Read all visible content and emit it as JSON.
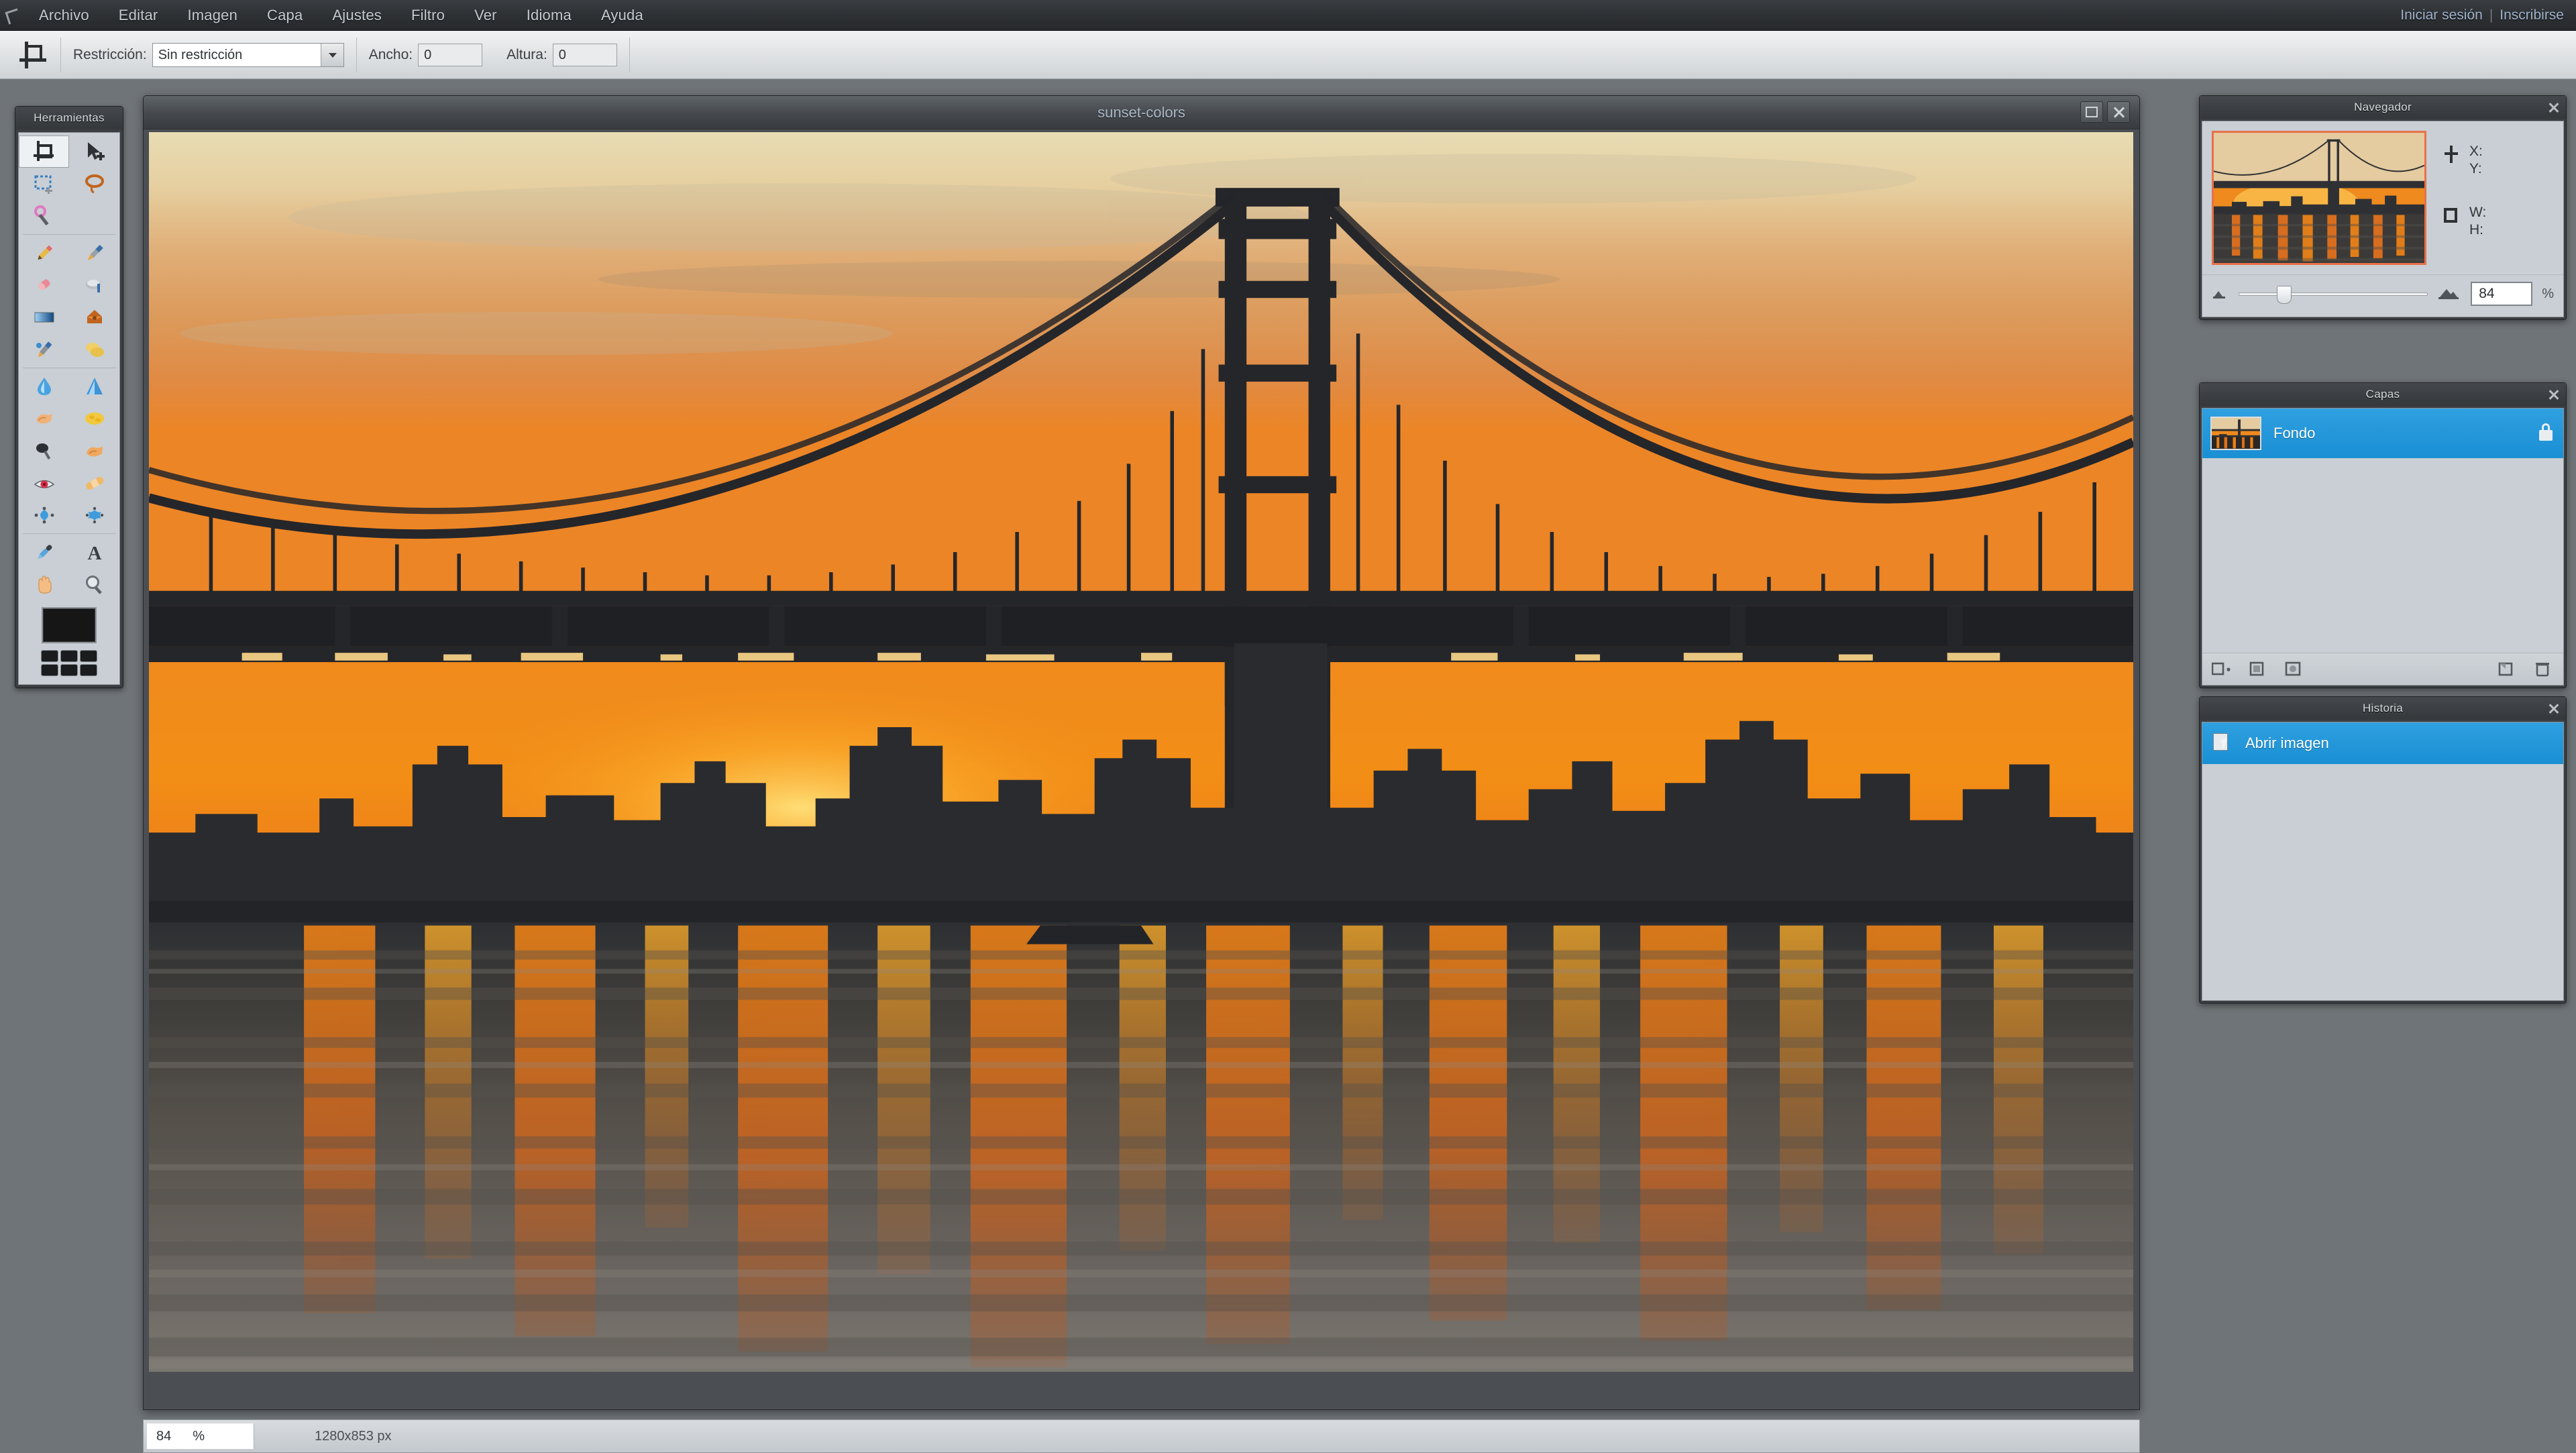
{
  "menubar": {
    "logo_icon": "crop-logo-icon",
    "items": [
      "Archivo",
      "Editar",
      "Imagen",
      "Capa",
      "Ajustes",
      "Filtro",
      "Ver",
      "Idioma",
      "Ayuda"
    ],
    "account": {
      "sign_in": "Iniciar sesión",
      "separator": "|",
      "sign_up": "Inscribirse"
    }
  },
  "options_bar": {
    "tool_icon": "crop-tool-icon",
    "constraint_label": "Restricción:",
    "constraint_value": "Sin restricción",
    "constraint_options": [
      "Sin restricción"
    ],
    "width_label": "Ancho:",
    "width_value": "0",
    "height_label": "Altura:",
    "height_value": "0"
  },
  "tools_panel": {
    "title": "Herramientas",
    "active_tool": "crop-tool",
    "tools": [
      {
        "name": "crop-tool",
        "icon": "crop-icon",
        "active": true
      },
      {
        "name": "move-tool",
        "icon": "arrow-move-icon",
        "active": false
      },
      {
        "name": "marquee-select-tool",
        "icon": "rectangle-marquee-icon",
        "active": false
      },
      {
        "name": "lasso-tool",
        "icon": "lasso-icon",
        "active": false
      },
      {
        "name": "wand-select-tool",
        "icon": "magic-wand-icon",
        "active": false
      },
      {
        "name": "pencil-tool",
        "icon": "pencil-icon",
        "active": false
      },
      {
        "name": "brush-tool",
        "icon": "paintbrush-icon",
        "active": false
      },
      {
        "name": "eraser-tool",
        "icon": "eraser-icon",
        "active": false
      },
      {
        "name": "clone-stamp-tool",
        "icon": "clone-stamp-icon",
        "active": false
      },
      {
        "name": "gradient-tool",
        "icon": "gradient-icon",
        "active": false
      },
      {
        "name": "paint-bucket-tool",
        "icon": "paint-bucket-icon",
        "active": false
      },
      {
        "name": "replace-color-tool",
        "icon": "color-replace-icon",
        "active": false
      },
      {
        "name": "drawing-tool",
        "icon": "shapes-icon",
        "active": false
      },
      {
        "name": "blur-tool",
        "icon": "water-drop-icon",
        "active": false
      },
      {
        "name": "sharpen-tool",
        "icon": "sharpen-triangle-icon",
        "active": false
      },
      {
        "name": "smudge-tool",
        "icon": "smudge-finger-icon",
        "active": false
      },
      {
        "name": "sponge-tool",
        "icon": "sponge-icon",
        "active": false
      },
      {
        "name": "dodge-tool",
        "icon": "dodge-icon",
        "active": false
      },
      {
        "name": "burn-tool",
        "icon": "burn-hand-icon",
        "active": false
      },
      {
        "name": "red-eye-tool",
        "icon": "red-eye-icon",
        "active": false
      },
      {
        "name": "spot-heal-tool",
        "icon": "bandage-icon",
        "active": false
      },
      {
        "name": "bloat-tool",
        "icon": "bloat-icon",
        "active": false
      },
      {
        "name": "pinch-tool",
        "icon": "pinch-star-icon",
        "active": false
      },
      {
        "name": "eyedropper-tool",
        "icon": "eyedropper-icon",
        "active": false
      },
      {
        "name": "type-tool",
        "icon": "text-a-icon",
        "active": false
      },
      {
        "name": "hand-tool",
        "icon": "hand-icon",
        "active": false
      },
      {
        "name": "zoom-tool",
        "icon": "magnifier-icon",
        "active": false
      }
    ],
    "foreground_color": "#161616",
    "palette_colors": [
      "#1b1c1d",
      "#1b1c1d",
      "#1b1c1d",
      "#1b1c1d",
      "#1b1c1d",
      "#1b1c1d"
    ]
  },
  "document": {
    "title": "sunset-colors",
    "maximize_icon": "maximize-icon",
    "close_icon": "close-icon",
    "image_alt": "sunset-colors"
  },
  "status_bar": {
    "zoom_value": "84",
    "zoom_unit": "%",
    "dimensions": "1280x853 px"
  },
  "navigator": {
    "title": "Navegador",
    "close_icon": "close-icon",
    "position_icon": "crosshair-icon",
    "x_label": "X:",
    "y_label": "Y:",
    "size_icon": "bounds-icon",
    "w_label": "W:",
    "h_label": "H:",
    "zoom_out_icon": "zoom-out-small-icon",
    "zoom_in_icon": "zoom-in-large-icon",
    "zoom_value": "84",
    "zoom_unit": "%"
  },
  "layers": {
    "title": "Capas",
    "close_icon": "close-icon",
    "rows": [
      {
        "name": "Fondo",
        "selected": true,
        "locked": true,
        "lock_icon": "lock-icon"
      }
    ],
    "footer_buttons": [
      {
        "name": "layer-settings-button",
        "icon": "layer-settings-icon"
      },
      {
        "name": "layer-style-button",
        "icon": "layer-style-icon"
      },
      {
        "name": "layer-mask-button",
        "icon": "layer-mask-icon"
      },
      {
        "name": "new-layer-button",
        "icon": "new-layer-icon"
      },
      {
        "name": "delete-layer-button",
        "icon": "trash-icon"
      }
    ]
  },
  "history": {
    "title": "Historia",
    "close_icon": "close-icon",
    "entries": [
      {
        "label": "Abrir imagen",
        "selected": true,
        "icon": "open-image-icon"
      }
    ]
  },
  "colors": {
    "accent_blue": "#1a8fd4",
    "panel_bg": "#c9cfd4",
    "panel_chrome": "#3b3e42",
    "app_bg": "#6f7478",
    "navigator_frame": "#e8714a"
  }
}
